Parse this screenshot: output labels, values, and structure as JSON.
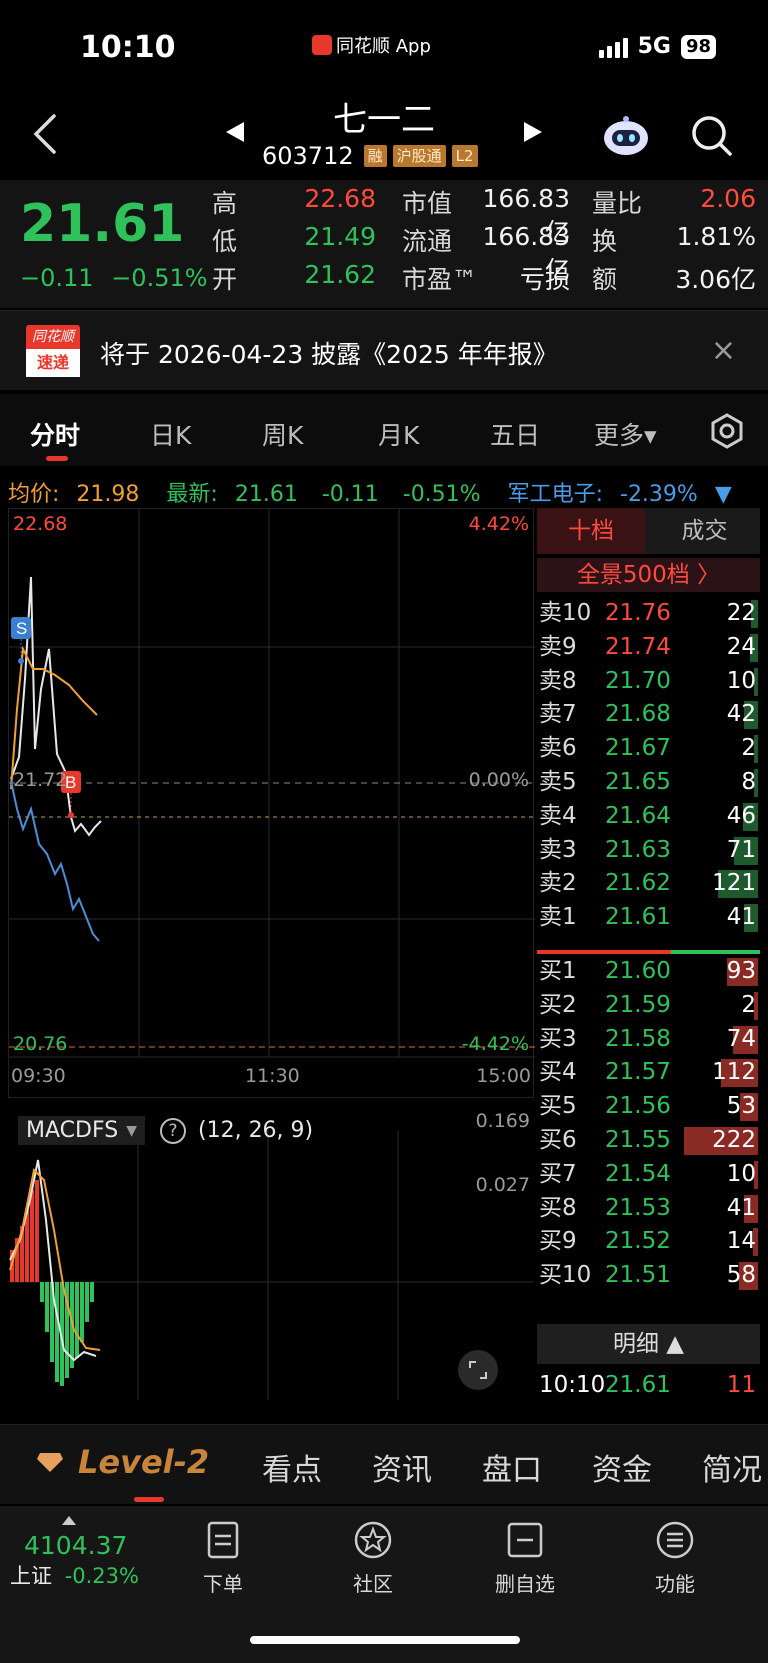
{
  "status_bar": {
    "time": "10:10",
    "app_badge": "同花顺 App",
    "network": "5G",
    "battery": "98"
  },
  "header": {
    "stock_name": "七一二",
    "stock_code": "603712",
    "tags": [
      "融",
      "沪股通",
      "L2"
    ]
  },
  "quote": {
    "price": "21.61",
    "change": "−0.11",
    "change_pct": "−0.51%",
    "high_label": "高",
    "high": "22.68",
    "low_label": "低",
    "low": "21.49",
    "open_label": "开",
    "open": "21.62",
    "mcap_label": "市值",
    "mcap": "166.83亿",
    "float_label": "流通",
    "float": "166.83亿",
    "pe_label": "市盈™",
    "pe": "亏损",
    "vol_ratio_label": "量比",
    "vol_ratio": "2.06",
    "turnover_label": "换",
    "turnover": "1.81%",
    "amount_label": "额",
    "amount": "3.06亿"
  },
  "notice": {
    "logo_top": "同花顺",
    "logo_bottom": "速递",
    "text": "将于 2026-04-23 披露《2025 年年报》",
    "close": "×"
  },
  "chart_tabs": [
    "分时",
    "日K",
    "周K",
    "月K",
    "五日",
    "更多▾"
  ],
  "info_line": {
    "avg_label": "均价:",
    "avg": "21.98",
    "latest_label": "最新:",
    "latest": "21.61",
    "latest_chg": "-0.11",
    "latest_pct": "-0.51%",
    "sector_label": "军工电子:",
    "sector_pct": "-2.39%",
    "sector_arrow": "▼"
  },
  "chart_labels": {
    "top_price": "22.68",
    "top_pct": "4.42%",
    "mid_price": "21.72",
    "mid_pct": "0.00%",
    "bottom_price": "20.76",
    "bottom_pct": "-4.42%",
    "t_start": "09:30",
    "t_mid": "11:30",
    "t_end": "15:00",
    "sell_marker": "S",
    "buy_marker": "B"
  },
  "macd": {
    "name": "MACDFS",
    "help": "?",
    "params": "(12, 26, 9)",
    "max": "0.169",
    "mid": "0.027"
  },
  "order_book": {
    "tab_ten": "十档",
    "tab_deal": "成交",
    "full_view": "全景500档 〉",
    "asks": [
      {
        "label": "卖10",
        "price": "21.76",
        "vol": "22"
      },
      {
        "label": "卖9",
        "price": "21.74",
        "vol": "24"
      },
      {
        "label": "卖8",
        "price": "21.70",
        "vol": "10"
      },
      {
        "label": "卖7",
        "price": "21.68",
        "vol": "42"
      },
      {
        "label": "卖6",
        "price": "21.67",
        "vol": "2"
      },
      {
        "label": "卖5",
        "price": "21.65",
        "vol": "8"
      },
      {
        "label": "卖4",
        "price": "21.64",
        "vol": "46"
      },
      {
        "label": "卖3",
        "price": "21.63",
        "vol": "71"
      },
      {
        "label": "卖2",
        "price": "21.62",
        "vol": "121"
      },
      {
        "label": "卖1",
        "price": "21.61",
        "vol": "41"
      }
    ],
    "bids": [
      {
        "label": "买1",
        "price": "21.60",
        "vol": "93"
      },
      {
        "label": "买2",
        "price": "21.59",
        "vol": "2"
      },
      {
        "label": "买3",
        "price": "21.58",
        "vol": "74"
      },
      {
        "label": "买4",
        "price": "21.57",
        "vol": "112"
      },
      {
        "label": "买5",
        "price": "21.56",
        "vol": "53"
      },
      {
        "label": "买6",
        "price": "21.55",
        "vol": "222"
      },
      {
        "label": "买7",
        "price": "21.54",
        "vol": "10"
      },
      {
        "label": "买8",
        "price": "21.53",
        "vol": "41"
      },
      {
        "label": "买9",
        "price": "21.52",
        "vol": "14"
      },
      {
        "label": "买10",
        "price": "21.51",
        "vol": "58"
      }
    ],
    "detail_btn": "明细 ▲",
    "last_trade": {
      "time": "10:10",
      "price": "21.61",
      "vol": "11"
    }
  },
  "bottom_tabs": {
    "level2": "Level-2",
    "items": [
      "看点",
      "资讯",
      "盘口",
      "资金",
      "简况"
    ]
  },
  "footer": {
    "index_value": "4104.37",
    "index_name": "上证",
    "index_pct": "-0.23%",
    "nav": [
      "下单",
      "社区",
      "删自选",
      "功能"
    ]
  },
  "colors": {
    "up": "#ff4a3d",
    "down": "#2fc25b",
    "avg_line": "#f0a030",
    "accent": "#e8372b"
  }
}
